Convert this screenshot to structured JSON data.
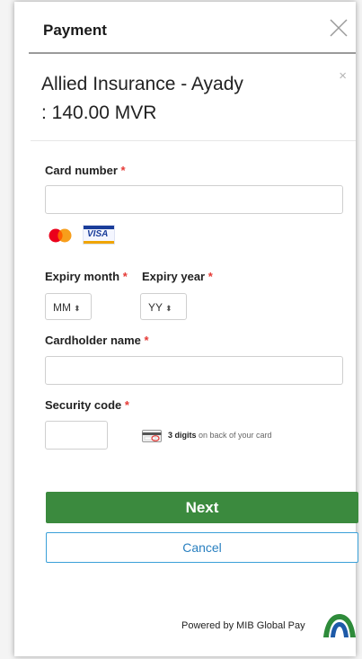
{
  "header": {
    "title": "Payment"
  },
  "merchant": {
    "line1": "Allied Insurance - Ayady",
    "line2": ": 140.00 MVR",
    "close_glyph": "×"
  },
  "form": {
    "required_mark": "*",
    "card_number": {
      "label": "Card number",
      "value": "",
      "placeholder": ""
    },
    "card_brands": [
      "mastercard",
      "VISA"
    ],
    "expiry_month": {
      "label": "Expiry month",
      "value": "MM"
    },
    "expiry_year": {
      "label": "Expiry year",
      "value": "YY"
    },
    "cardholder": {
      "label": "Cardholder name",
      "value": ""
    },
    "security": {
      "label": "Security code",
      "hint_bold": "3 digits",
      "hint_rest": " on back of your card"
    }
  },
  "actions": {
    "next_label": "Next",
    "cancel_label": "Cancel"
  },
  "footer": {
    "powered_by": "Powered by MIB Global Pay"
  },
  "colors": {
    "primary": "#3b8a3e",
    "link": "#2a80c0",
    "required": "#e53935",
    "logo_green": "#2e8b3a",
    "logo_blue": "#1e5aa8"
  },
  "icons": {
    "header_close": "close-icon",
    "expiry_select": "chevron-updown-icon",
    "cvv": "credit-card-back-icon",
    "brand_logo": "mib-logo"
  }
}
